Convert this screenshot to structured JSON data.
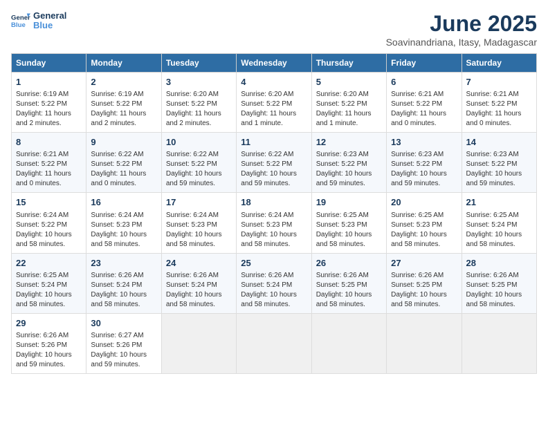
{
  "logo": {
    "line1": "General",
    "line2": "Blue"
  },
  "title": "June 2025",
  "subtitle": "Soavinandriana, Itasy, Madagascar",
  "headers": [
    "Sunday",
    "Monday",
    "Tuesday",
    "Wednesday",
    "Thursday",
    "Friday",
    "Saturday"
  ],
  "weeks": [
    [
      {
        "day": "1",
        "info": "Sunrise: 6:19 AM\nSunset: 5:22 PM\nDaylight: 11 hours and 2 minutes."
      },
      {
        "day": "2",
        "info": "Sunrise: 6:19 AM\nSunset: 5:22 PM\nDaylight: 11 hours and 2 minutes."
      },
      {
        "day": "3",
        "info": "Sunrise: 6:20 AM\nSunset: 5:22 PM\nDaylight: 11 hours and 2 minutes."
      },
      {
        "day": "4",
        "info": "Sunrise: 6:20 AM\nSunset: 5:22 PM\nDaylight: 11 hours and 1 minute."
      },
      {
        "day": "5",
        "info": "Sunrise: 6:20 AM\nSunset: 5:22 PM\nDaylight: 11 hours and 1 minute."
      },
      {
        "day": "6",
        "info": "Sunrise: 6:21 AM\nSunset: 5:22 PM\nDaylight: 11 hours and 0 minutes."
      },
      {
        "day": "7",
        "info": "Sunrise: 6:21 AM\nSunset: 5:22 PM\nDaylight: 11 hours and 0 minutes."
      }
    ],
    [
      {
        "day": "8",
        "info": "Sunrise: 6:21 AM\nSunset: 5:22 PM\nDaylight: 11 hours and 0 minutes."
      },
      {
        "day": "9",
        "info": "Sunrise: 6:22 AM\nSunset: 5:22 PM\nDaylight: 11 hours and 0 minutes."
      },
      {
        "day": "10",
        "info": "Sunrise: 6:22 AM\nSunset: 5:22 PM\nDaylight: 10 hours and 59 minutes."
      },
      {
        "day": "11",
        "info": "Sunrise: 6:22 AM\nSunset: 5:22 PM\nDaylight: 10 hours and 59 minutes."
      },
      {
        "day": "12",
        "info": "Sunrise: 6:23 AM\nSunset: 5:22 PM\nDaylight: 10 hours and 59 minutes."
      },
      {
        "day": "13",
        "info": "Sunrise: 6:23 AM\nSunset: 5:22 PM\nDaylight: 10 hours and 59 minutes."
      },
      {
        "day": "14",
        "info": "Sunrise: 6:23 AM\nSunset: 5:22 PM\nDaylight: 10 hours and 59 minutes."
      }
    ],
    [
      {
        "day": "15",
        "info": "Sunrise: 6:24 AM\nSunset: 5:22 PM\nDaylight: 10 hours and 58 minutes."
      },
      {
        "day": "16",
        "info": "Sunrise: 6:24 AM\nSunset: 5:23 PM\nDaylight: 10 hours and 58 minutes."
      },
      {
        "day": "17",
        "info": "Sunrise: 6:24 AM\nSunset: 5:23 PM\nDaylight: 10 hours and 58 minutes."
      },
      {
        "day": "18",
        "info": "Sunrise: 6:24 AM\nSunset: 5:23 PM\nDaylight: 10 hours and 58 minutes."
      },
      {
        "day": "19",
        "info": "Sunrise: 6:25 AM\nSunset: 5:23 PM\nDaylight: 10 hours and 58 minutes."
      },
      {
        "day": "20",
        "info": "Sunrise: 6:25 AM\nSunset: 5:23 PM\nDaylight: 10 hours and 58 minutes."
      },
      {
        "day": "21",
        "info": "Sunrise: 6:25 AM\nSunset: 5:24 PM\nDaylight: 10 hours and 58 minutes."
      }
    ],
    [
      {
        "day": "22",
        "info": "Sunrise: 6:25 AM\nSunset: 5:24 PM\nDaylight: 10 hours and 58 minutes."
      },
      {
        "day": "23",
        "info": "Sunrise: 6:26 AM\nSunset: 5:24 PM\nDaylight: 10 hours and 58 minutes."
      },
      {
        "day": "24",
        "info": "Sunrise: 6:26 AM\nSunset: 5:24 PM\nDaylight: 10 hours and 58 minutes."
      },
      {
        "day": "25",
        "info": "Sunrise: 6:26 AM\nSunset: 5:24 PM\nDaylight: 10 hours and 58 minutes."
      },
      {
        "day": "26",
        "info": "Sunrise: 6:26 AM\nSunset: 5:25 PM\nDaylight: 10 hours and 58 minutes."
      },
      {
        "day": "27",
        "info": "Sunrise: 6:26 AM\nSunset: 5:25 PM\nDaylight: 10 hours and 58 minutes."
      },
      {
        "day": "28",
        "info": "Sunrise: 6:26 AM\nSunset: 5:25 PM\nDaylight: 10 hours and 58 minutes."
      }
    ],
    [
      {
        "day": "29",
        "info": "Sunrise: 6:26 AM\nSunset: 5:26 PM\nDaylight: 10 hours and 59 minutes."
      },
      {
        "day": "30",
        "info": "Sunrise: 6:27 AM\nSunset: 5:26 PM\nDaylight: 10 hours and 59 minutes."
      },
      {
        "day": "",
        "info": ""
      },
      {
        "day": "",
        "info": ""
      },
      {
        "day": "",
        "info": ""
      },
      {
        "day": "",
        "info": ""
      },
      {
        "day": "",
        "info": ""
      }
    ]
  ]
}
